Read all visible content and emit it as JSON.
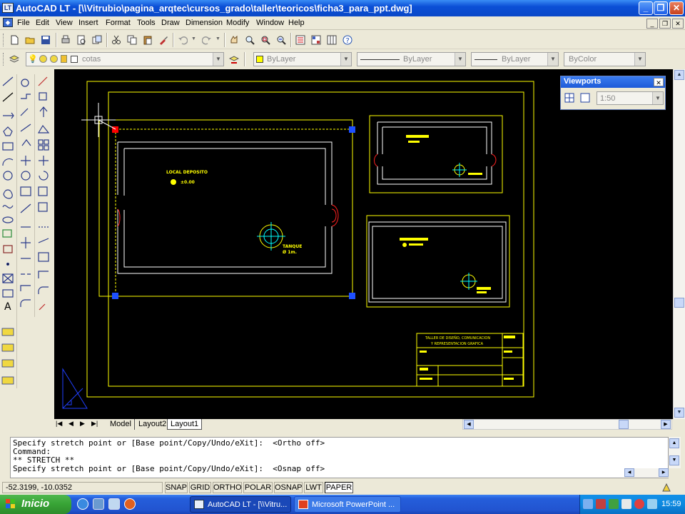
{
  "window": {
    "title": "AutoCAD LT - [\\\\Vitrubio\\pagina_arqtec\\cursos_grado\\taller\\teoricos\\ficha3_para_ppt.dwg]",
    "logo_text": "LT",
    "minimize": "_",
    "maximize": "❐",
    "close": "✕"
  },
  "menu": {
    "items": [
      "File",
      "Edit",
      "View",
      "Insert",
      "Format",
      "Tools",
      "Draw",
      "Dimension",
      "Modify",
      "Window",
      "Help"
    ],
    "doc_min": "_",
    "doc_restore": "❐",
    "doc_close": "✕"
  },
  "layers": {
    "current_layer": "cotas",
    "color": "ByLayer",
    "linetype": "ByLayer",
    "lineweight": "ByLayer",
    "plotstyle": "ByColor"
  },
  "viewports": {
    "title": "Viewports",
    "close": "✕",
    "scale": "1:50"
  },
  "drawing": {
    "room_label": "LOCAL DEPOSITO",
    "level_label": "±0.00",
    "tank_label": "TANQUE",
    "tank_size": "Ø 1m.",
    "titleblock_line1": "TALLER DE DISEÑO, COMUNICACION",
    "titleblock_line2": "Y REPRESENTACION GRAFICA"
  },
  "layout_tabs": {
    "nav": [
      "|◀",
      "◀",
      "▶",
      "▶|"
    ],
    "tabs": [
      "Model",
      "Layout2",
      "Layout1"
    ],
    "active": "Layout1"
  },
  "command": {
    "lines": [
      "Specify stretch point or [Base point/Copy/Undo/eXit]:  <Ortho off>",
      "Command:",
      "** STRETCH **",
      "Specify stretch point or [Base point/Copy/Undo/eXit]:  <Osnap off>"
    ]
  },
  "status": {
    "coords": "-52.3199, -10.0352",
    "toggles": [
      "SNAP",
      "GRID",
      "ORTHO",
      "POLAR",
      "OSNAP",
      "LWT",
      "PAPER"
    ]
  },
  "taskbar": {
    "start": "Inicio",
    "tasks": [
      "AutoCAD LT - [\\\\Vitru...",
      "Microsoft PowerPoint ..."
    ],
    "clock": "15:59"
  },
  "colors": {
    "titlebar": "#0b4fd6",
    "canvas": "#000000",
    "drawing_yellow": "#ffff00",
    "drawing_white": "#ffffff",
    "grip_blue": "#1e50ff",
    "grip_red": "#ff0000",
    "taskbar": "#245edb",
    "start_green": "#37a335"
  }
}
